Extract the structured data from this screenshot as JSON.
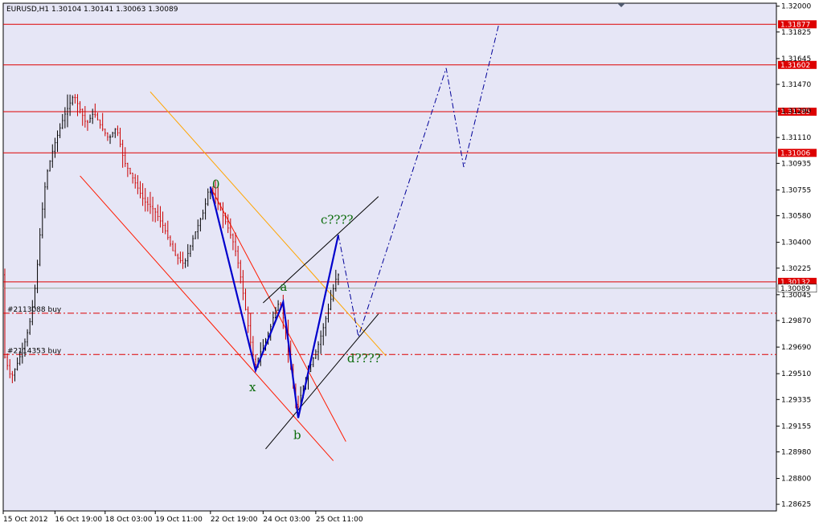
{
  "chart_title": "EURUSD,H1  1.30104 1.30141 1.30063 1.30089",
  "colors": {
    "background": "#e6e6f6",
    "grid": "#b4b4c8",
    "bull_candle": "#000000",
    "bear_candle": "#cc0000",
    "horizontal_lines": "#dd0000",
    "channel": "#ff1a00",
    "fib_line": "#ffa500",
    "wave": "#0000cc",
    "projection": "#000099",
    "labels": "#0a6b0a",
    "bid_line": "#9aa79a"
  },
  "chart_data": {
    "type": "candlestick",
    "symbol": "EURUSD",
    "timeframe": "H1",
    "ohlc_header": {
      "open": 1.30104,
      "high": 1.30141,
      "low": 1.30063,
      "close": 1.30089
    },
    "ylim": [
      1.2858,
      1.3202
    ],
    "y_ticks": [
      "1.32000",
      "1.31825",
      "1.31645",
      "1.31470",
      "1.31290",
      "1.31110",
      "1.30935",
      "1.30755",
      "1.30580",
      "1.30400",
      "1.30225",
      "1.30045",
      "1.29870",
      "1.29690",
      "1.29510",
      "1.29335",
      "1.29155",
      "1.28980",
      "1.28800",
      "1.28625"
    ],
    "x_tick_labels": [
      "15 Oct 2012",
      "16 Oct 19:00",
      "18 Oct 03:00",
      "19 Oct 11:00",
      "22 Oct 19:00",
      "24 Oct 03:00",
      "25 Oct 11:00"
    ],
    "price_path": [
      [
        0,
        1.2965
      ],
      [
        3,
        1.2948
      ],
      [
        6,
        1.296
      ],
      [
        9,
        1.2975
      ],
      [
        11,
        1.299
      ],
      [
        13,
        1.3015
      ],
      [
        15,
        1.3055
      ],
      [
        17,
        1.3085
      ],
      [
        20,
        1.3105
      ],
      [
        24,
        1.3125
      ],
      [
        28,
        1.314
      ],
      [
        30,
        1.3132
      ],
      [
        33,
        1.312
      ],
      [
        36,
        1.3128
      ],
      [
        39,
        1.3118
      ],
      [
        42,
        1.311
      ],
      [
        45,
        1.3118
      ],
      [
        48,
        1.3095
      ],
      [
        52,
        1.3082
      ],
      [
        56,
        1.3068
      ],
      [
        60,
        1.3062
      ],
      [
        64,
        1.305
      ],
      [
        68,
        1.3032
      ],
      [
        72,
        1.3025
      ],
      [
        76,
        1.3045
      ],
      [
        80,
        1.3062
      ],
      [
        82,
        1.3078
      ],
      [
        85,
        1.3068
      ],
      [
        89,
        1.3052
      ],
      [
        92,
        1.3038
      ],
      [
        94,
        1.3022
      ],
      [
        96,
        1.3
      ],
      [
        98,
        1.2978
      ],
      [
        100,
        1.2955
      ],
      [
        103,
        1.2968
      ],
      [
        106,
        1.298
      ],
      [
        108,
        1.2992
      ],
      [
        110,
        1.3
      ],
      [
        112,
        1.2985
      ],
      [
        114,
        1.296
      ],
      [
        116,
        1.2935
      ],
      [
        117,
        1.2925
      ],
      [
        119,
        1.294
      ],
      [
        122,
        1.2955
      ],
      [
        125,
        1.2968
      ],
      [
        128,
        1.2985
      ],
      [
        130,
        1.2998
      ],
      [
        132,
        1.3012
      ],
      [
        133,
        1.3018
      ]
    ],
    "total_bars": 134,
    "horizontal_levels": [
      {
        "price": 1.31877,
        "label": "1.31877"
      },
      {
        "price": 1.31602,
        "label": "1.31602"
      },
      {
        "price": 1.31285,
        "label": "1.31285"
      },
      {
        "price": 1.31006,
        "label": "1.31006"
      },
      {
        "price": 1.30132,
        "label": "1.30132"
      },
      {
        "price": 1.30089,
        "label": "1.30089"
      }
    ],
    "orders": [
      {
        "label": "#2113088 buy",
        "price": 1.2992
      },
      {
        "label": "#2114353 buy",
        "price": 1.2964
      }
    ],
    "wave_points": [
      {
        "name": "0",
        "x": 82,
        "price": 1.30775
      },
      {
        "name": "x",
        "x": 100,
        "price": 1.29532
      },
      {
        "name": "a",
        "x": 111,
        "price": 1.29995
      },
      {
        "name": "b",
        "x": 117,
        "price": 1.2921
      },
      {
        "name": "c????",
        "x": 133,
        "price": 1.3045
      }
    ],
    "projection_points": [
      {
        "x": 133,
        "price": 1.3045
      },
      {
        "x": 141,
        "price": 1.2976
      },
      {
        "x": 176,
        "price": 1.3158
      },
      {
        "x": 183,
        "price": 1.3091
      },
      {
        "x": 197,
        "price": 1.31877
      }
    ],
    "d_label": "d????",
    "trendlines": [
      {
        "kind": "channel",
        "from": {
          "x": 30,
          "price": 1.3085
        },
        "to": {
          "x": 131,
          "price": 1.2892
        }
      },
      {
        "kind": "channel",
        "from": {
          "x": 82,
          "price": 1.30775
        },
        "to": {
          "x": 136,
          "price": 1.2905
        }
      },
      {
        "kind": "fib",
        "from": {
          "x": 58,
          "price": 1.3142
        },
        "to": {
          "x": 152,
          "price": 1.2963
        }
      },
      {
        "kind": "parallel",
        "from": {
          "x": 103,
          "price": 1.2999
        },
        "to": {
          "x": 149,
          "price": 1.3071
        }
      },
      {
        "kind": "parallel",
        "from": {
          "x": 104,
          "price": 1.29
        },
        "to": {
          "x": 149,
          "price": 1.29915
        }
      }
    ]
  }
}
